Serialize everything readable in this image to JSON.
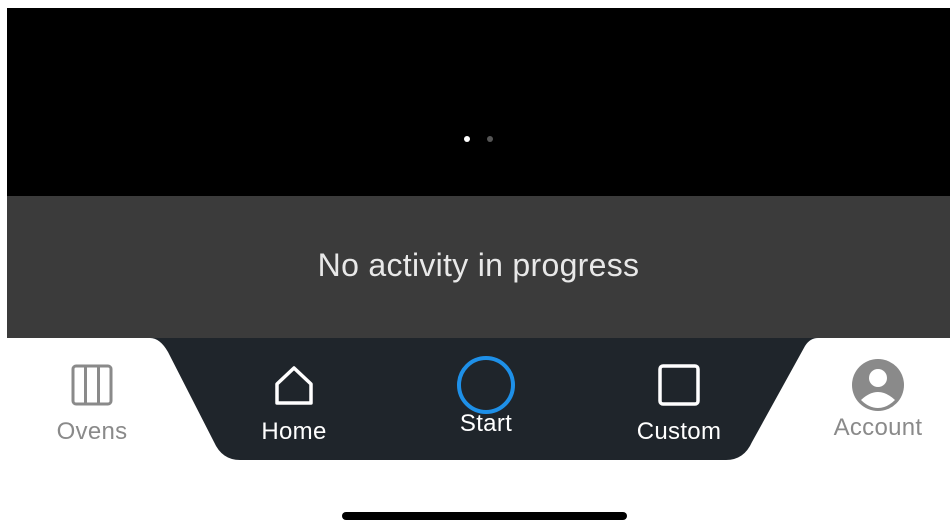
{
  "carousel": {
    "page_count": 2,
    "active_index": 0
  },
  "activity": {
    "status_text": "No activity in progress"
  },
  "nav": {
    "items": [
      {
        "id": "ovens",
        "label": "Ovens",
        "icon": "ovens-icon"
      },
      {
        "id": "home",
        "label": "Home",
        "icon": "home-icon"
      },
      {
        "id": "start",
        "label": "Start",
        "icon": "start-ring-icon"
      },
      {
        "id": "custom",
        "label": "Custom",
        "icon": "custom-square-icon"
      },
      {
        "id": "account",
        "label": "Account",
        "icon": "account-icon"
      }
    ]
  },
  "colors": {
    "hero_bg": "#000000",
    "activity_bg": "#3b3b3b",
    "nav_panel_bg": "#1f252b",
    "accent_blue": "#1e90e8",
    "muted_gray": "#8a8a8a"
  }
}
